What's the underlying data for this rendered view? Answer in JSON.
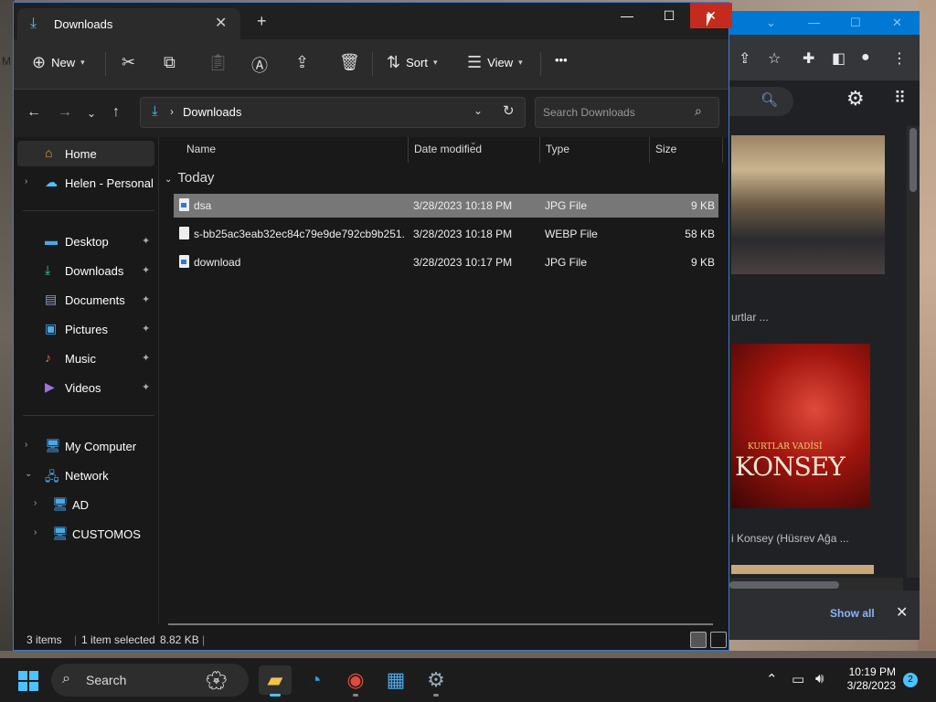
{
  "desktop": {
    "partial_text": "M"
  },
  "explorer": {
    "tab_title": "Downloads",
    "new_tab_symbol": "+",
    "commands": {
      "new": "New",
      "sort": "Sort",
      "view": "View",
      "more": "•••"
    },
    "address": {
      "path": "Downloads"
    },
    "search": {
      "placeholder": "Search Downloads"
    },
    "sidebar": [
      {
        "label": "Home",
        "icon": "home-icon"
      },
      {
        "label": "Helen - Personal",
        "icon": "cloud-icon"
      },
      {
        "label": "Desktop",
        "icon": "desktop-folder-icon"
      },
      {
        "label": "Downloads",
        "icon": "download-icon"
      },
      {
        "label": "Documents",
        "icon": "documents-icon"
      },
      {
        "label": "Pictures",
        "icon": "pictures-icon"
      },
      {
        "label": "Music",
        "icon": "music-icon"
      },
      {
        "label": "Videos",
        "icon": "videos-icon"
      },
      {
        "label": "My Computer",
        "icon": "monitor-icon"
      },
      {
        "label": "Network",
        "icon": "network-icon"
      },
      {
        "label": "AD",
        "icon": "monitor-icon"
      },
      {
        "label": "CUSTOMOS",
        "icon": "monitor-icon"
      }
    ],
    "columns": {
      "name": "Name",
      "date": "Date modified",
      "type": "Type",
      "size": "Size"
    },
    "group": "Today",
    "files": [
      {
        "name": "dsa",
        "date": "3/28/2023 10:18 PM",
        "type": "JPG File",
        "size": "9 KB"
      },
      {
        "name": "s-bb25ac3eab32ec84c79e9de792cb9b251...",
        "date": "3/28/2023 10:18 PM",
        "type": "WEBP File",
        "size": "58 KB"
      },
      {
        "name": "download",
        "date": "3/28/2023 10:17 PM",
        "type": "JPG File",
        "size": "9 KB"
      }
    ],
    "status": {
      "items": "3 items",
      "selected": "1 item selected",
      "size": "8.82 KB"
    }
  },
  "browser": {
    "caption1": "urtlar ...",
    "caption2": "i Konsey (Hüsrev Ağa ...",
    "image_logo": "KONSEY",
    "image_sub": "KURTLAR VADİSİ",
    "show_all": "Show all"
  },
  "taskbar": {
    "search": "Search",
    "time": "10:19 PM",
    "date": "3/28/2023",
    "notifications": "2"
  },
  "colors": {
    "accent": "#4cc2ff",
    "close_red": "#c42b1c",
    "selected_row": "#777777"
  }
}
